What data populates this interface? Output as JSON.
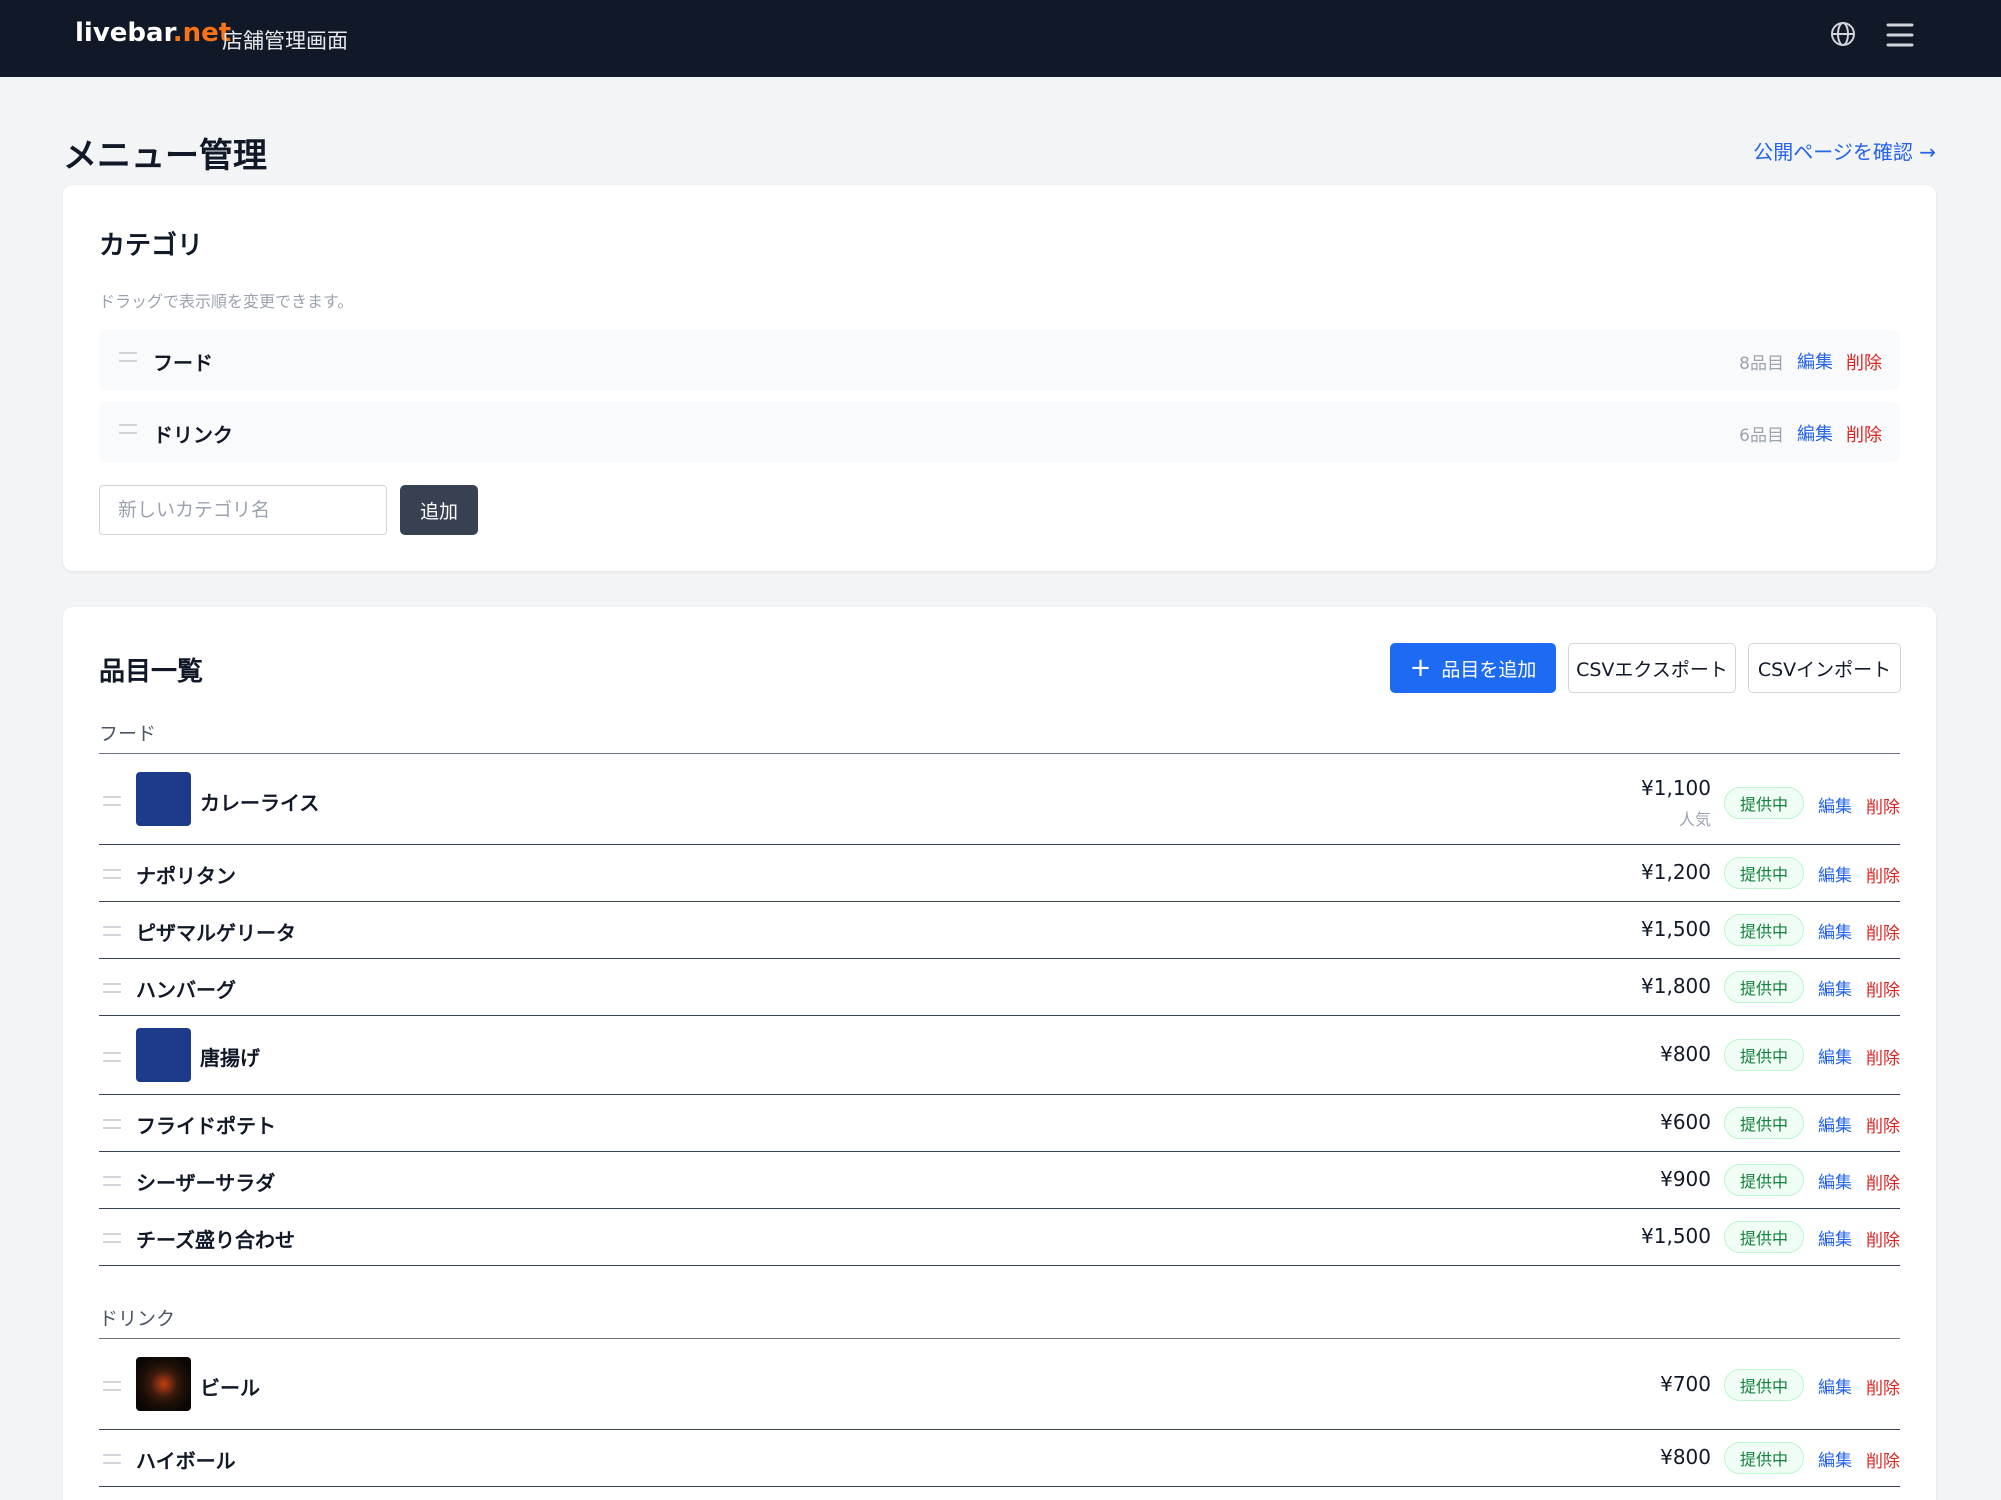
{
  "header": {
    "brand_main": "livebar",
    "brand_tld": ".net",
    "subtitle": "店舗管理画面",
    "icons": [
      "globe-icon",
      "menu-icon"
    ]
  },
  "page": {
    "title": "メニュー管理",
    "public_link": "公開ページを確認 →"
  },
  "categories": {
    "heading": "カテゴリ",
    "hint": "ドラッグで表示順を変更できます。",
    "items": [
      {
        "name": "フード",
        "count": "8品目",
        "edit": "編集",
        "delete": "削除"
      },
      {
        "name": "ドリンク",
        "count": "6品目",
        "edit": "編集",
        "delete": "削除"
      }
    ],
    "new_placeholder": "新しいカテゴリ名",
    "add_label": "追加"
  },
  "items": {
    "heading": "品目一覧",
    "add_label": "品目を追加",
    "csv_export": "CSVエクスポート",
    "csv_import": "CSVインポート",
    "groups": [
      {
        "name": "フード",
        "rows": [
          {
            "name": "カレーライス",
            "price": "¥1,100",
            "tag": "人気",
            "status": "提供中",
            "edit": "編集",
            "delete": "削除"
          },
          {
            "name": "ナポリタン",
            "price": "¥1,200",
            "status": "提供中",
            "edit": "編集",
            "delete": "削除"
          },
          {
            "name": "ピザマルゲリータ",
            "price": "¥1,500",
            "status": "提供中",
            "edit": "編集",
            "delete": "削除"
          },
          {
            "name": "ハンバーグ",
            "price": "¥1,800",
            "status": "提供中",
            "edit": "編集",
            "delete": "削除"
          },
          {
            "name": "唐揚げ",
            "price": "¥800",
            "status": "提供中",
            "edit": "編集",
            "delete": "削除"
          },
          {
            "name": "フライドポテト",
            "price": "¥600",
            "status": "提供中",
            "edit": "編集",
            "delete": "削除"
          },
          {
            "name": "シーザーサラダ",
            "price": "¥900",
            "status": "提供中",
            "edit": "編集",
            "delete": "削除"
          },
          {
            "name": "チーズ盛り合わせ",
            "price": "¥1,500",
            "status": "提供中",
            "edit": "編集",
            "delete": "削除"
          }
        ]
      },
      {
        "name": "ドリンク",
        "rows": [
          {
            "name": "ビール",
            "price": "¥700",
            "status": "提供中",
            "edit": "編集",
            "delete": "削除"
          },
          {
            "name": "ハイボール",
            "price": "¥800",
            "status": "提供中",
            "edit": "編集",
            "delete": "削除"
          }
        ]
      }
    ]
  },
  "colors": {
    "header_bg": "#111827",
    "brand_accent": "#f97316",
    "primary": "#1d6bf3",
    "link": "#2563eb",
    "danger": "#dc2626",
    "status_green": "#15803d"
  }
}
